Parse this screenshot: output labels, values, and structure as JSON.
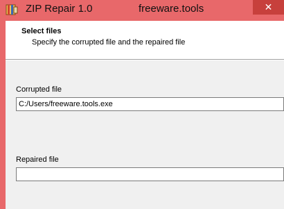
{
  "window": {
    "app_title": "ZIP Repair 1.0",
    "site_title": "freeware.tools",
    "close_symbol": "✕",
    "app_icon": "zip-archive-icon"
  },
  "header": {
    "title": "Select files",
    "subtitle": "Specify the corrupted file and the repaired file"
  },
  "form": {
    "corrupted_label": "Corrupted file",
    "corrupted_value": "C:/Users/freeware.tools.exe",
    "repaired_label": "Repaired file",
    "repaired_value": ""
  }
}
